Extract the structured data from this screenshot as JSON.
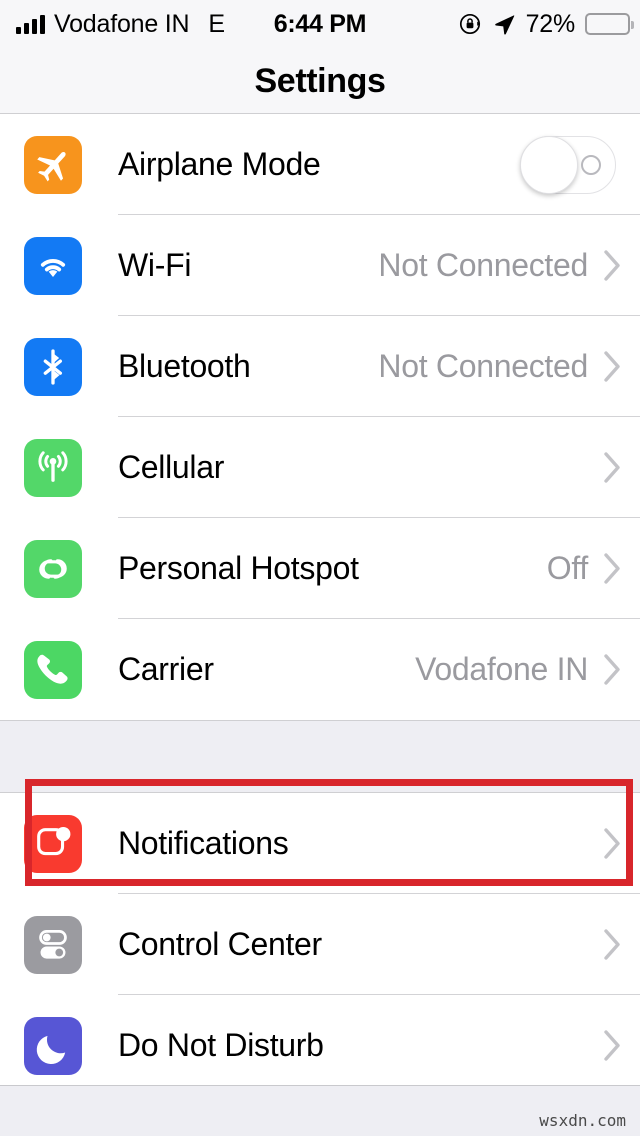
{
  "status_bar": {
    "carrier": "Vodafone IN",
    "network_type": "E",
    "time": "6:44 PM",
    "battery_percent": "72%",
    "battery_level": 72,
    "icons": [
      "signal-bars-icon",
      "rotation-lock-icon",
      "location-arrow-icon",
      "battery-icon"
    ]
  },
  "nav": {
    "title": "Settings"
  },
  "groups": [
    {
      "id": "connectivity",
      "rows": [
        {
          "name": "airplane-mode",
          "label": "Airplane Mode",
          "icon": "airplane-icon",
          "icon_color": "#F7941D",
          "accessory": "toggle",
          "toggle_on": false,
          "value": ""
        },
        {
          "name": "wifi",
          "label": "Wi-Fi",
          "icon": "wifi-icon",
          "icon_color": "#137AF4",
          "accessory": "chevron",
          "value": "Not Connected"
        },
        {
          "name": "bluetooth",
          "label": "Bluetooth",
          "icon": "bluetooth-icon",
          "icon_color": "#137AF4",
          "accessory": "chevron",
          "value": "Not Connected"
        },
        {
          "name": "cellular",
          "label": "Cellular",
          "icon": "cellular-antenna-icon",
          "icon_color": "#53D769",
          "accessory": "chevron",
          "value": ""
        },
        {
          "name": "personal-hotspot",
          "label": "Personal Hotspot",
          "icon": "hotspot-link-icon",
          "icon_color": "#53D769",
          "accessory": "chevron",
          "value": "Off"
        },
        {
          "name": "carrier",
          "label": "Carrier",
          "icon": "phone-handset-icon",
          "icon_color": "#4CD764",
          "accessory": "chevron",
          "value": "Vodafone IN"
        }
      ]
    },
    {
      "id": "notifications-group",
      "rows": [
        {
          "name": "notifications",
          "label": "Notifications",
          "icon": "notification-badge-icon",
          "icon_color": "#F93A2F",
          "accessory": "chevron",
          "value": "",
          "highlighted": true
        },
        {
          "name": "control-center",
          "label": "Control Center",
          "icon": "control-center-toggles-icon",
          "icon_color": "#9B9BA0",
          "accessory": "chevron",
          "value": ""
        },
        {
          "name": "do-not-disturb",
          "label": "Do Not Disturb",
          "icon": "crescent-moon-icon",
          "icon_color": "#5756D5",
          "accessory": "chevron",
          "value": ""
        }
      ]
    }
  ],
  "annotation": {
    "highlight_color": "#D8262B",
    "highlight_target": "Notifications"
  },
  "footer": {
    "watermark": "wsxdn.com"
  }
}
